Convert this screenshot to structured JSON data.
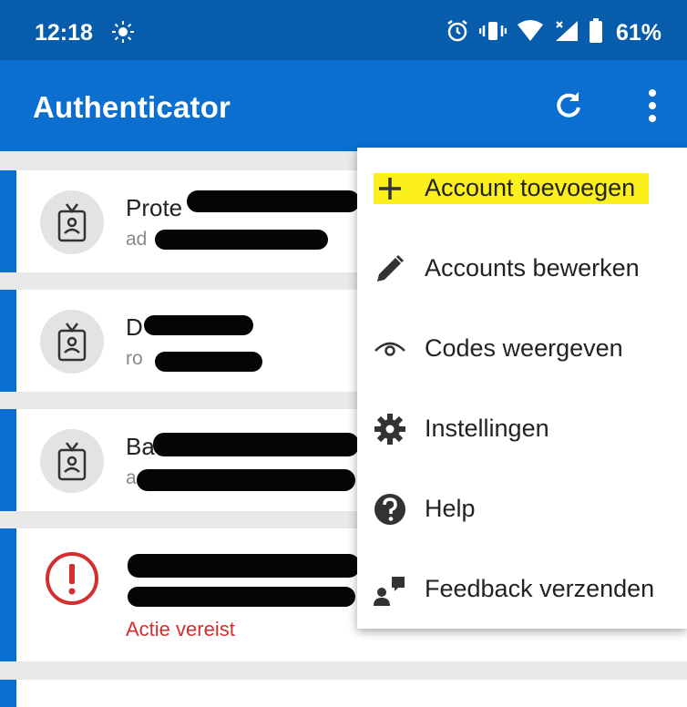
{
  "status_bar": {
    "time": "12:18",
    "battery": "61%",
    "icons": [
      "brightness-icon",
      "alarm-icon",
      "vibrate-icon",
      "wifi-icon",
      "signal-icon",
      "battery-icon"
    ]
  },
  "app_bar": {
    "title": "Authenticator",
    "icons": [
      "refresh-icon",
      "more-vert-icon"
    ]
  },
  "accounts": [
    {
      "name": "Prote",
      "email": "ad",
      "status": ""
    },
    {
      "name": "D",
      "email": "ro",
      "status": ""
    },
    {
      "name": "Ba",
      "email": "a",
      "status": ""
    },
    {
      "name": "",
      "email": "",
      "status": "Actie vereist"
    }
  ],
  "menu": {
    "items": [
      {
        "label": "Account toevoegen",
        "icon": "plus-icon",
        "highlighted": true
      },
      {
        "label": "Accounts bewerken",
        "icon": "pencil-icon"
      },
      {
        "label": "Codes weergeven",
        "icon": "eye-icon"
      },
      {
        "label": "Instellingen",
        "icon": "gear-icon"
      },
      {
        "label": "Help",
        "icon": "help-icon"
      },
      {
        "label": "Feedback verzenden",
        "icon": "feedback-icon"
      }
    ]
  },
  "colors": {
    "status_bar": "#075dab",
    "app_bar": "#0a6fd0",
    "accent": "#0a6fd0",
    "error": "#d32f2f",
    "highlight": "#fbf01b"
  }
}
